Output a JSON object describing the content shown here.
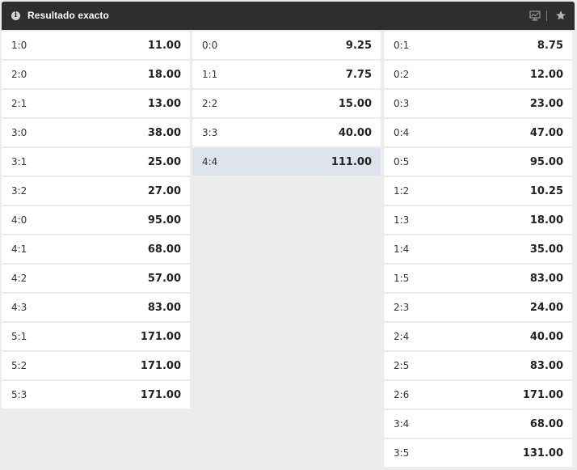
{
  "header": {
    "info_icon": "info-icon",
    "info_glyph": "i",
    "title": "Resultado exacto",
    "icons": [
      "stats-monitor-icon",
      "star-icon"
    ],
    "background_color": "#2e2e2e"
  },
  "colors": {
    "row_background": "#ffffff",
    "row_selected_background": "#dfe3ec",
    "page_background": "#ececec"
  },
  "columns": [
    {
      "rows": [
        {
          "score": "1:0",
          "odds": "11.00"
        },
        {
          "score": "2:0",
          "odds": "18.00"
        },
        {
          "score": "2:1",
          "odds": "13.00"
        },
        {
          "score": "3:0",
          "odds": "38.00"
        },
        {
          "score": "3:1",
          "odds": "25.00"
        },
        {
          "score": "3:2",
          "odds": "27.00"
        },
        {
          "score": "4:0",
          "odds": "95.00"
        },
        {
          "score": "4:1",
          "odds": "68.00"
        },
        {
          "score": "4:2",
          "odds": "57.00"
        },
        {
          "score": "4:3",
          "odds": "83.00"
        },
        {
          "score": "5:1",
          "odds": "171.00"
        },
        {
          "score": "5:2",
          "odds": "171.00"
        },
        {
          "score": "5:3",
          "odds": "171.00"
        }
      ]
    },
    {
      "rows": [
        {
          "score": "0:0",
          "odds": "9.25"
        },
        {
          "score": "1:1",
          "odds": "7.75"
        },
        {
          "score": "2:2",
          "odds": "15.00"
        },
        {
          "score": "3:3",
          "odds": "40.00"
        },
        {
          "score": "4:4",
          "odds": "111.00",
          "selected": true
        }
      ]
    },
    {
      "rows": [
        {
          "score": "0:1",
          "odds": "8.75"
        },
        {
          "score": "0:2",
          "odds": "12.00"
        },
        {
          "score": "0:3",
          "odds": "23.00"
        },
        {
          "score": "0:4",
          "odds": "47.00"
        },
        {
          "score": "0:5",
          "odds": "95.00"
        },
        {
          "score": "1:2",
          "odds": "10.25"
        },
        {
          "score": "1:3",
          "odds": "18.00"
        },
        {
          "score": "1:4",
          "odds": "35.00"
        },
        {
          "score": "1:5",
          "odds": "83.00"
        },
        {
          "score": "2:3",
          "odds": "24.00"
        },
        {
          "score": "2:4",
          "odds": "40.00"
        },
        {
          "score": "2:5",
          "odds": "83.00"
        },
        {
          "score": "2:6",
          "odds": "171.00"
        },
        {
          "score": "3:4",
          "odds": "68.00"
        },
        {
          "score": "3:5",
          "odds": "131.00"
        }
      ]
    }
  ]
}
